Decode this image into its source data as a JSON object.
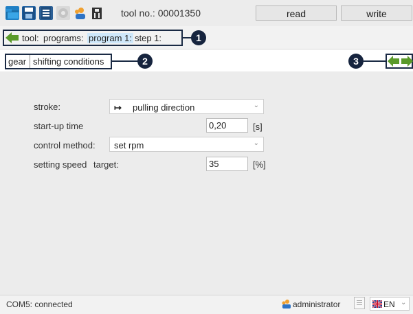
{
  "toolbar": {
    "icons": [
      "folder-icon",
      "save-icon",
      "print-icon",
      "settings-icon",
      "user-icon",
      "trash-icon"
    ],
    "tool_no_label": "tool no.:",
    "tool_no_value": "00001350",
    "read_label": "read",
    "write_label": "write"
  },
  "breadcrumb": {
    "items": [
      "tool:",
      "programs:",
      "program 1:",
      "step 1:"
    ],
    "active_index": 2
  },
  "callouts": [
    "1",
    "2",
    "3"
  ],
  "tabs": [
    {
      "label": "gear",
      "active": true
    },
    {
      "label": "shifting conditions",
      "active": false
    }
  ],
  "form": {
    "stroke_label": "stroke:",
    "stroke_value": "pulling direction",
    "stroke_glyph": "↦",
    "startup_label": "start-up time",
    "startup_value": "0,20",
    "startup_unit": "[s]",
    "control_label": "control method:",
    "control_value": "set rpm",
    "speed_label": "setting speed",
    "speed_sub_label": "target:",
    "speed_value": "35",
    "speed_unit": "[%]"
  },
  "status": {
    "connection": "COM5: connected",
    "user": "administrator",
    "language": "EN"
  },
  "colors": {
    "callout": "#16243e",
    "arrow_green": "#5a9a2a",
    "active_crumb": "#cfe8fb"
  }
}
